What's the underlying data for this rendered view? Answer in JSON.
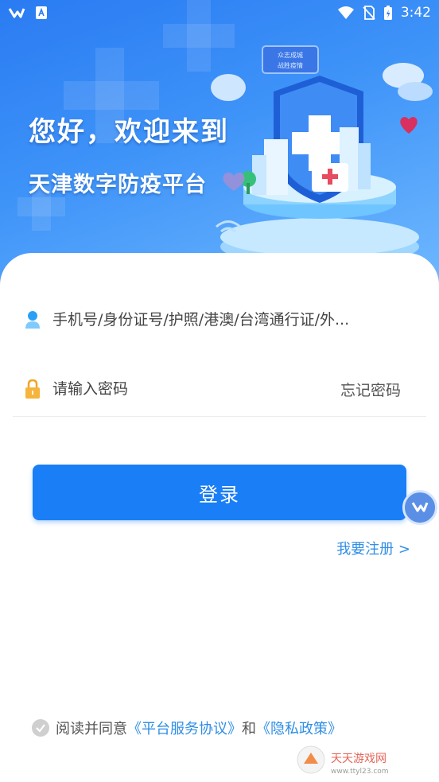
{
  "status_bar": {
    "time": "3:42"
  },
  "hero": {
    "greeting_line1": "您好，欢迎来到",
    "greeting_line2": "天津数字防疫平台",
    "sign_text_1": "众志成城",
    "sign_text_2": "战胜疫情"
  },
  "login": {
    "phone_placeholder": "手机号/身份证号/护照/港澳/台湾通行证/外...",
    "password_placeholder": "请输入密码",
    "forgot_label": "忘记密码",
    "login_label": "登录",
    "register_label": "我要注册 >"
  },
  "agreement": {
    "prefix": "阅读并同意",
    "service_link": "《平台服务协议》",
    "and": "和",
    "privacy_link": "《隐私政策》"
  },
  "watermark": {
    "text": "天天游戏网",
    "url_text": "www.ttyl23.com"
  },
  "colors": {
    "primary": "#1a7ef7",
    "link": "#2f8ee6",
    "hero_top": "#2a7bf2"
  }
}
